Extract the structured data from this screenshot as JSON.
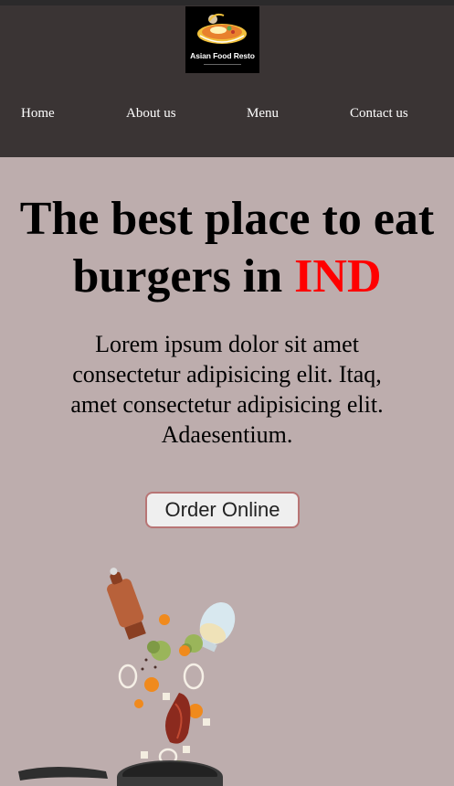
{
  "brand": {
    "name": "Asian Food Resto",
    "logo_icon": "bowl-dish-icon"
  },
  "nav": {
    "items": [
      {
        "label": "Home"
      },
      {
        "label": "About us"
      },
      {
        "label": "Menu"
      },
      {
        "label": "Contact us"
      }
    ]
  },
  "hero": {
    "title_prefix": "The best place to eat burgers in",
    "title_highlight": "IND",
    "text": "Lorem ipsum dolor sit amet consectetur adipisicing elit. Itaq, amet consectetur adipisicing elit. Adaesentium.",
    "cta_label": "Order Online",
    "illustration": "flying-vegetables-pan-illustration"
  },
  "colors": {
    "header_bg": "#3a3434",
    "page_bg": "#bdadad",
    "highlight": "#ff0000",
    "button_border": "#b87575"
  }
}
